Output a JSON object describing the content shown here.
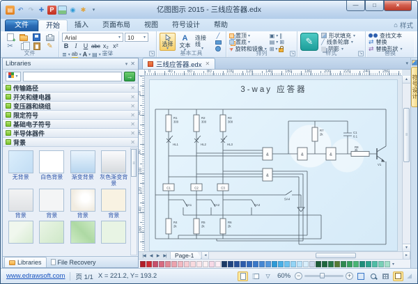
{
  "window": {
    "title": "亿图图示 2015 - 三线应答器.edx"
  },
  "menu": {
    "file": "文件",
    "tabs": [
      {
        "label": "开始",
        "active": true
      },
      {
        "label": "插入",
        "active": false
      },
      {
        "label": "页面布局",
        "active": false
      },
      {
        "label": "视图",
        "active": false
      },
      {
        "label": "符号设计",
        "active": false
      },
      {
        "label": "帮助",
        "active": false
      }
    ],
    "style_button": "样式"
  },
  "ribbon": {
    "groups": {
      "file": {
        "label": "文件"
      },
      "font": {
        "label": "字体",
        "font_name": "Arial",
        "font_size": "10",
        "buttons": [
          "B",
          "I",
          "U",
          "abc",
          "x₂",
          "x²"
        ]
      },
      "basic_tools": {
        "label": "基本工具",
        "select": "选择",
        "text": "文本",
        "connector": "连接线"
      },
      "arrange": {
        "label": "排列",
        "items": [
          "置顶",
          "置底",
          "旋转和镜像"
        ]
      },
      "style": {
        "label": "样式",
        "items": [
          "形状填充",
          "线条轮廓",
          "阴影"
        ]
      },
      "replace": {
        "label": "替换",
        "items": [
          "查找文本",
          "替换",
          "替换形状"
        ]
      }
    }
  },
  "libraries": {
    "title": "Libraries",
    "groups": [
      "传输路径",
      "开关和继电器",
      "变压器和绕组",
      "限定符号",
      "基础电子符号",
      "半导体器件",
      "背景"
    ],
    "thumbnails": [
      {
        "label": "无背景",
        "style": "t-none"
      },
      {
        "label": "白色背景",
        "style": "t-white"
      },
      {
        "label": "渐变背景",
        "style": "t-grad-blue"
      },
      {
        "label": "灰色渐变背景",
        "style": "t-grad-gray"
      },
      {
        "label": "背景",
        "style": "t-gray1"
      },
      {
        "label": "背景",
        "style": "t-gray2"
      },
      {
        "label": "背景",
        "style": "t-swirl"
      },
      {
        "label": "背景",
        "style": "t-cream"
      },
      {
        "label": "",
        "style": "t-green1"
      },
      {
        "label": "",
        "style": "t-green2"
      },
      {
        "label": "",
        "style": "t-green3"
      },
      {
        "label": "",
        "style": "t-green4"
      }
    ],
    "bottom_tabs": [
      "Libraries",
      "File Recovery"
    ]
  },
  "document": {
    "tab": "三线应答器.edx",
    "page_tab": "Page-1",
    "ruler_labels": [
      "0",
      "40",
      "60",
      "80",
      "100",
      "120",
      "140",
      "160",
      "180",
      "200",
      "220",
      "240",
      "260"
    ],
    "ruler_v_labels": [
      "20",
      "40",
      "60",
      "80",
      "100",
      "120",
      "140",
      "160"
    ]
  },
  "side_tab": {
    "label": "符号设计"
  },
  "diagram": {
    "title": "3-way 应答器",
    "gate": "&",
    "resistors_top": [
      {
        "ref": "R1",
        "val": "300"
      },
      {
        "ref": "R2",
        "val": "300"
      },
      {
        "ref": "R3",
        "val": "300"
      }
    ],
    "lamps": [
      "HL1",
      "HL2",
      "HL3"
    ],
    "blocks": [
      "C1",
      "C2",
      "C3"
    ],
    "resistors_bottom": [
      {
        "ref": "R4",
        "val": "2k"
      },
      {
        "ref": "R5",
        "val": "2k"
      },
      {
        "ref": "R6",
        "val": "2k"
      }
    ],
    "r7": {
      "ref": "R7",
      "val": "2k"
    },
    "r8": {
      "ref": "R8",
      "val": "2k"
    },
    "capacitor": {
      "ref": "C1",
      "val": "0.1"
    },
    "switches": [
      "SA1",
      "SA2",
      "SA3",
      "SA4"
    ],
    "transistor": "V1"
  },
  "palette": {
    "colors": [
      "#b21e28",
      "#d02a31",
      "#c8506a",
      "#d76b80",
      "#e38793",
      "#eca3ad",
      "#f2b9c1",
      "#f6cbd1",
      "#f9dade",
      "#fbe6e9",
      "#fcf0f1",
      "#f7d9e6",
      "#fdeef4",
      "#1b3a66",
      "#1f437f",
      "#274f98",
      "#2d5cab",
      "#3369bb",
      "#3a78c8",
      "#4587d3",
      "#5296dc",
      "#2e9ad6",
      "#49afe6",
      "#6cc2ef",
      "#93d4f6",
      "#bce4fa",
      "#d9effc",
      "#ccd9ea",
      "#1c5b36",
      "#20683e",
      "#277746",
      "#567c33",
      "#2f8a50",
      "#37a05d",
      "#49b573",
      "#1e8e79",
      "#2ba38c",
      "#4fbda4",
      "#79d0b6",
      "#a5e0c9"
    ]
  },
  "statusbar": {
    "link": "www.edrawsoft.com",
    "page_info": "页 1/1",
    "coords": "X = 221.2, Y= 193.2",
    "zoom_level": "60%"
  },
  "icons": {
    "undo": "↶",
    "redo": "↷",
    "add": "✚",
    "app": "▤",
    "letter_p": "P",
    "eye": "◉",
    "star": "✱",
    "dropdown": "▾",
    "up": "▴",
    "down": "▾",
    "left": "◂",
    "right": "▸",
    "nav_first": "|◀",
    "nav_prev": "◀",
    "nav_next": "▶",
    "nav_last": "▶|",
    "close": "×",
    "minimize": "—",
    "maximize": "□",
    "x_small": "✕",
    "scissors": "✂",
    "pencil": "✎",
    "swap": "⇄",
    "line": "╱",
    "grip": "≡",
    "launcher": "↘",
    "funnel": "▽",
    "minus": "−",
    "plus": "+",
    "go": "→",
    "linespacing": "≣",
    "highlight": "ab",
    "fontcolor": "A",
    "align": "▤",
    "bullets": "≔",
    "group_sel": "▣",
    "pipes": "∥",
    "grid_sm": "⊞",
    "style_brush": "✎",
    "home": "⌂",
    "resize": "◢"
  }
}
